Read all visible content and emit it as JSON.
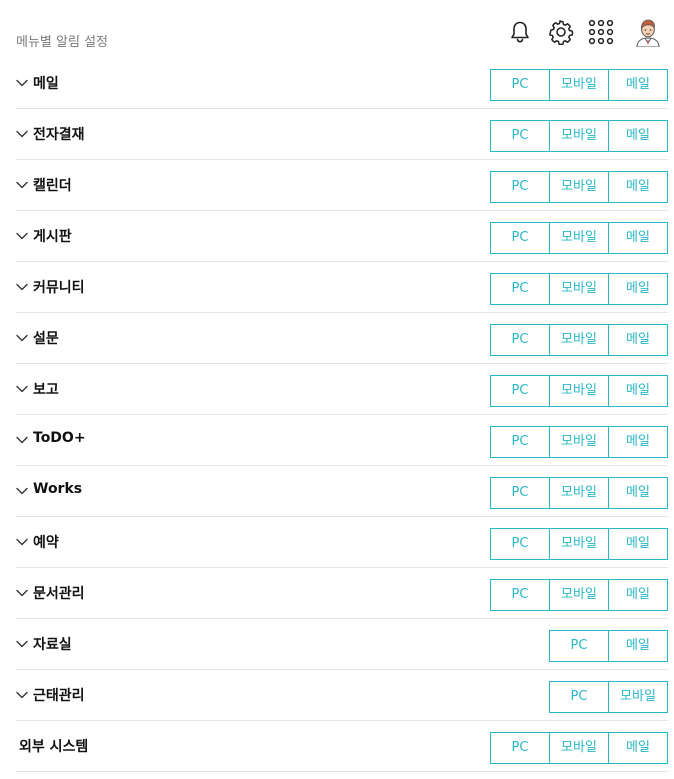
{
  "header": {
    "title": "메뉴별 알림 설정",
    "icons": [
      "bell-icon",
      "gear-icon",
      "apps-grid-icon",
      "avatar"
    ]
  },
  "accent_color": "#29b8c6",
  "menus": [
    {
      "label": "메일",
      "options": [
        "PC",
        "모바일",
        "메일"
      ]
    },
    {
      "label": "전자결재",
      "options": [
        "PC",
        "모바일",
        "메일"
      ]
    },
    {
      "label": "캘린더",
      "options": [
        "PC",
        "모바일",
        "메일"
      ]
    },
    {
      "label": "게시판",
      "options": [
        "PC",
        "모바일",
        "메일"
      ]
    },
    {
      "label": "커뮤니티",
      "options": [
        "PC",
        "모바일",
        "메일"
      ]
    },
    {
      "label": "설문",
      "options": [
        "PC",
        "모바일",
        "메일"
      ]
    },
    {
      "label": "보고",
      "options": [
        "PC",
        "모바일",
        "메일"
      ]
    },
    {
      "label": "ToDO+",
      "options": [
        "PC",
        "모바일",
        "메일"
      ]
    },
    {
      "label": "Works",
      "options": [
        "PC",
        "모바일",
        "메일"
      ]
    },
    {
      "label": "예약",
      "options": [
        "PC",
        "모바일",
        "메일"
      ]
    },
    {
      "label": "문서관리",
      "options": [
        "PC",
        "모바일",
        "메일"
      ]
    },
    {
      "label": "자료실",
      "options": [
        "PC",
        "메일"
      ]
    },
    {
      "label": "근태관리",
      "options": [
        "PC",
        "모바일"
      ]
    },
    {
      "label": "외부 시스템",
      "options": [
        "PC",
        "모바일",
        "메일"
      ],
      "no_chevron": true
    }
  ]
}
